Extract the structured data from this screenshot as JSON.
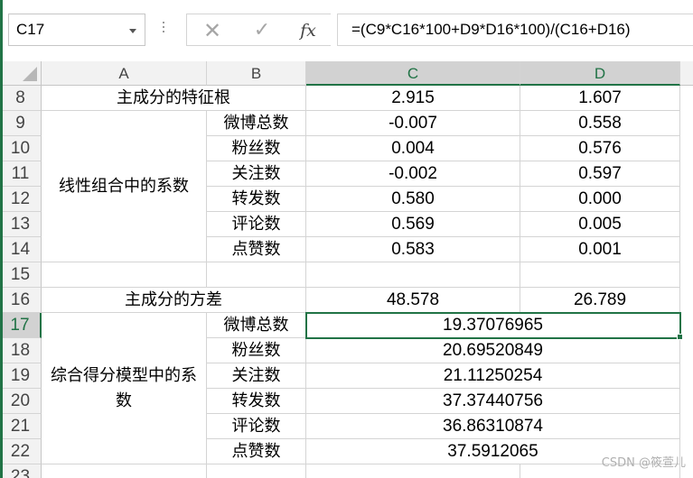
{
  "formula_bar": {
    "name_box": "C17",
    "cancel_icon": "cross-icon",
    "enter_icon": "check-icon",
    "fx_label": "fx",
    "formula": "=(C9*C16*100+D9*D16*100)/(C16+D16)"
  },
  "columns": [
    "A",
    "B",
    "C",
    "D"
  ],
  "rows": [
    "8",
    "9",
    "10",
    "11",
    "12",
    "13",
    "14",
    "15",
    "16",
    "17",
    "18",
    "19",
    "20",
    "21",
    "22",
    "23"
  ],
  "cells": {
    "r8_ab": "主成分的特征根",
    "r8_c": "2.915",
    "r8_d": "1.607",
    "group1_label": "线性组合中的系数",
    "coef_rows": [
      {
        "b": "微博总数",
        "c": "-0.007",
        "d": "0.558"
      },
      {
        "b": "粉丝数",
        "c": "0.004",
        "d": "0.576"
      },
      {
        "b": "关注数",
        "c": "-0.002",
        "d": "0.597"
      },
      {
        "b": "转发数",
        "c": "0.580",
        "d": "0.000"
      },
      {
        "b": "评论数",
        "c": "0.569",
        "d": "0.005"
      },
      {
        "b": "点赞数",
        "c": "0.583",
        "d": "0.001"
      }
    ],
    "r16_ab": "主成分的方差",
    "r16_c": "48.578",
    "r16_d": "26.789",
    "group2_label": "综合得分模型中的系数",
    "score_rows": [
      {
        "b": "微博总数",
        "cd": "19.37076965"
      },
      {
        "b": "粉丝数",
        "cd": "20.69520849"
      },
      {
        "b": "关注数",
        "cd": "21.11250254"
      },
      {
        "b": "转发数",
        "cd": "37.37440756"
      },
      {
        "b": "评论数",
        "cd": "36.86310874"
      },
      {
        "b": "点赞数",
        "cd": "37.5912065"
      }
    ]
  },
  "selection": "C17",
  "watermark": "CSDN @筱萱儿"
}
